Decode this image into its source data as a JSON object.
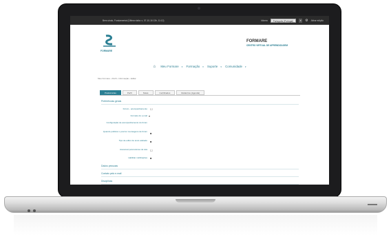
{
  "screen": {
    "topbar": {
      "user_text": "Bem-vindo, Fundamental (Última visita: x, 07-10-16 13h, 11:12)",
      "lang_label": "Idioma",
      "lang_value": "Português (Portugal)",
      "help_label": "Ativar edição"
    },
    "logo_text": "FORMARE",
    "brand": {
      "title": "FORMARE",
      "subtitle": "CENTRO VIRTUAL DE APRENDIZAGEM"
    },
    "menu": [
      "Meu Formare",
      "Formação",
      "Suporte",
      "Comunidade"
    ],
    "breadcrumb": "Meu Formare › Perfil › Informação › Editar",
    "tabs": [
      "Preferências",
      "Perfil",
      "Notas",
      "Certificados",
      "Relatórios (Agenda)"
    ],
    "sections": [
      "Preferências gerais",
      "Dados pessoais",
      "Contato pelo e-mail",
      "Disciplinas"
    ],
    "fields": [
      {
        "label": "Fórum - acompanhamento",
        "value": "☐"
      },
      {
        "label": "Formato do e-mail",
        "value": "▾"
      },
      {
        "label": "Configuração de acompanhamento do fórum",
        "value": ""
      },
      {
        "label": "Quando publicar o post ler mensagens de fórum",
        "value": "■"
      },
      {
        "label": "Tipo de editor de texto adotado",
        "value": "■"
      },
      {
        "label": "Acessível para leitores de tela",
        "value": "☐"
      },
      {
        "label": "Habilitar notificações",
        "value": "■"
      }
    ],
    "colors": {
      "accent": "#2b7f93",
      "topbar": "#2b2b2b"
    }
  },
  "icons": [
    "home-icon",
    "gear-icon",
    "formare-logo-icon"
  ]
}
